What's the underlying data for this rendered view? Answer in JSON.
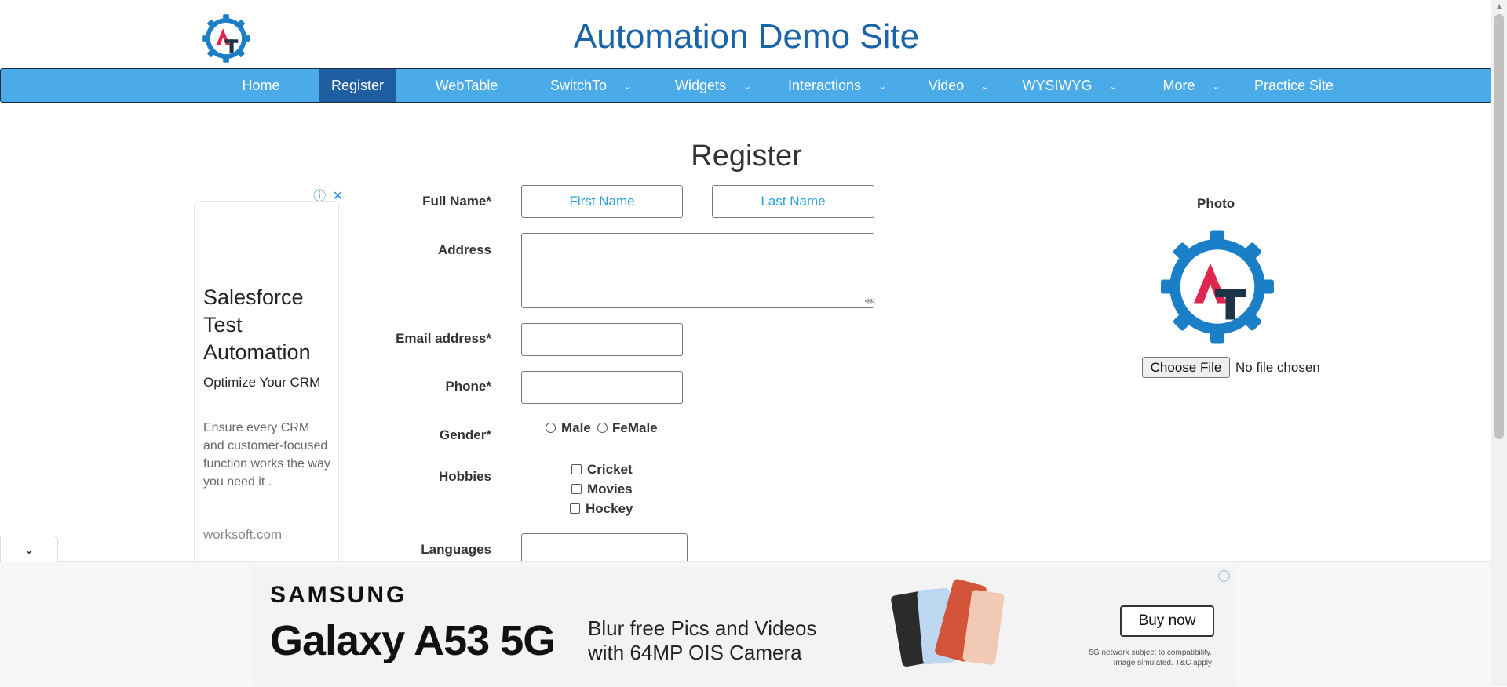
{
  "site": {
    "title": "Automation Demo Site"
  },
  "nav": {
    "items": [
      {
        "label": "Home",
        "dropdown": false,
        "active": false
      },
      {
        "label": "Register",
        "dropdown": false,
        "active": true
      },
      {
        "label": "WebTable",
        "dropdown": false,
        "active": false
      },
      {
        "label": "SwitchTo",
        "dropdown": true,
        "active": false
      },
      {
        "label": "Widgets",
        "dropdown": true,
        "active": false
      },
      {
        "label": "Interactions",
        "dropdown": true,
        "active": false
      },
      {
        "label": "Video",
        "dropdown": true,
        "active": false
      },
      {
        "label": "WYSIWYG",
        "dropdown": true,
        "active": false
      },
      {
        "label": "More",
        "dropdown": true,
        "active": false
      },
      {
        "label": "Practice Site",
        "dropdown": false,
        "active": false
      }
    ],
    "colors": {
      "bar": "#4baae8",
      "active": "#1f5ea0"
    }
  },
  "form": {
    "heading": "Register",
    "full_name_label": "Full Name*",
    "first_name_placeholder": "First Name",
    "last_name_placeholder": "Last Name",
    "address_label": "Address",
    "email_label": "Email address*",
    "phone_label": "Phone*",
    "gender_label": "Gender*",
    "gender_options": [
      "Male",
      "FeMale"
    ],
    "hobbies_label": "Hobbies",
    "hobbies_options": [
      "Cricket",
      "Movies",
      "Hockey"
    ],
    "languages_label": "Languages"
  },
  "photo": {
    "label": "Photo",
    "choose_file_label": "Choose File",
    "file_status": "No file chosen"
  },
  "left_ad": {
    "headline": "Salesforce Test Automation",
    "subhead": "Optimize Your CRM",
    "body": "Ensure every CRM and customer-focused function works the way you need it .",
    "domain": "worksoft.com"
  },
  "bottom_ad": {
    "brand": "SAMSUNG",
    "product": "Galaxy A53 5G",
    "tagline": "Blur free Pics and Videos with 64MP OIS Camera",
    "cta": "Buy now",
    "fineprint": "5G network subject to compatibility. Image simulated. T&C apply"
  },
  "icons": {
    "ad_info": "info-icon",
    "ad_close": "close-icon",
    "collapse": "chevron-down-icon"
  }
}
